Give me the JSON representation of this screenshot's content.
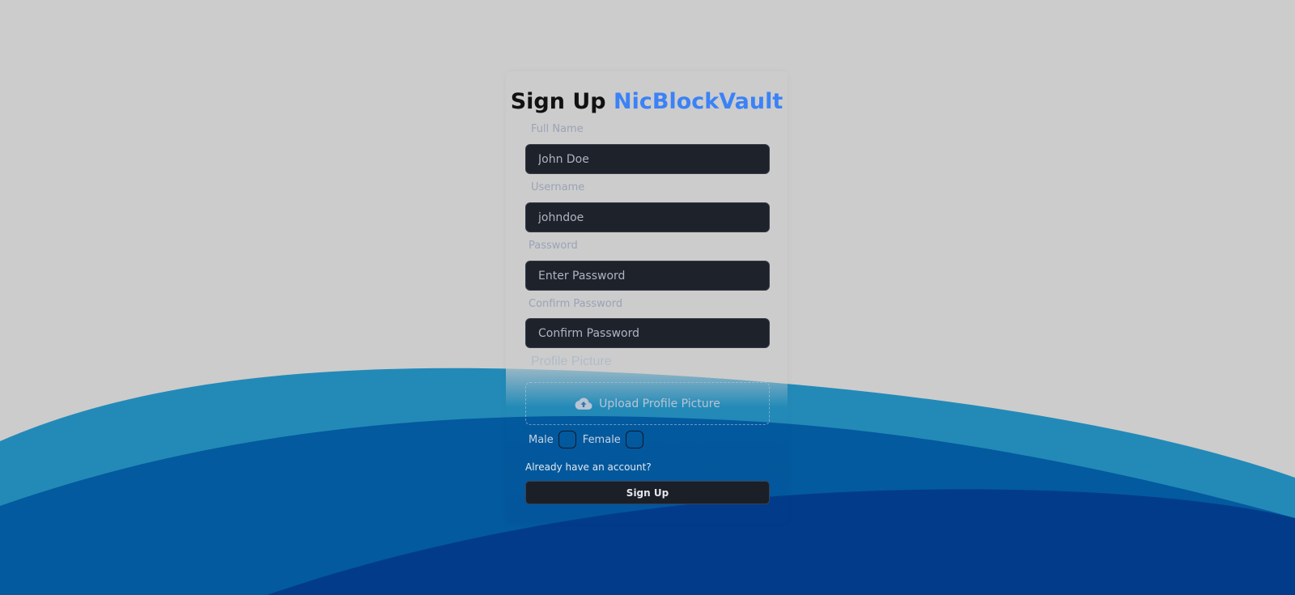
{
  "page": {
    "title_prefix": "Sign Up",
    "title_brand": "NicBlockVault",
    "brand_color": "#3b82f6"
  },
  "form": {
    "full_name": {
      "label": "Full Name",
      "placeholder": "John Doe",
      "value": ""
    },
    "username": {
      "label": "Username",
      "placeholder": "johndoe",
      "value": ""
    },
    "password": {
      "label": "Password",
      "placeholder": "Enter Password",
      "value": ""
    },
    "confirm_password": {
      "label": "Confirm Password",
      "placeholder": "Confirm Password",
      "value": ""
    },
    "profile_picture": {
      "label": "Profile Picture",
      "upload_label": "Upload Profile Picture",
      "icon": "cloud-upload-icon"
    },
    "gender": {
      "male_label": "Male",
      "female_label": "Female"
    },
    "login_link": "Already have an account?",
    "submit_label": "Sign Up"
  },
  "colors": {
    "background": "#cccccc",
    "input_background": "#1e222b",
    "wave_light": "#238ab8",
    "wave_mid": "#035a9e",
    "wave_dark": "#023b8a"
  }
}
